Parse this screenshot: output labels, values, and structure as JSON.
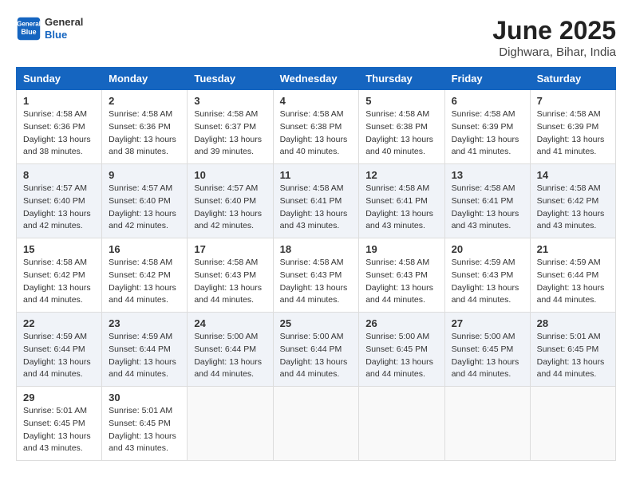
{
  "header": {
    "logo_line1": "General",
    "logo_line2": "Blue",
    "month": "June 2025",
    "location": "Dighwara, Bihar, India"
  },
  "weekdays": [
    "Sunday",
    "Monday",
    "Tuesday",
    "Wednesday",
    "Thursday",
    "Friday",
    "Saturday"
  ],
  "weeks": [
    [
      {
        "day": "1",
        "sunrise": "4:58 AM",
        "sunset": "6:36 PM",
        "daylight": "13 hours and 38 minutes."
      },
      {
        "day": "2",
        "sunrise": "4:58 AM",
        "sunset": "6:36 PM",
        "daylight": "13 hours and 38 minutes."
      },
      {
        "day": "3",
        "sunrise": "4:58 AM",
        "sunset": "6:37 PM",
        "daylight": "13 hours and 39 minutes."
      },
      {
        "day": "4",
        "sunrise": "4:58 AM",
        "sunset": "6:38 PM",
        "daylight": "13 hours and 40 minutes."
      },
      {
        "day": "5",
        "sunrise": "4:58 AM",
        "sunset": "6:38 PM",
        "daylight": "13 hours and 40 minutes."
      },
      {
        "day": "6",
        "sunrise": "4:58 AM",
        "sunset": "6:39 PM",
        "daylight": "13 hours and 41 minutes."
      },
      {
        "day": "7",
        "sunrise": "4:58 AM",
        "sunset": "6:39 PM",
        "daylight": "13 hours and 41 minutes."
      }
    ],
    [
      {
        "day": "8",
        "sunrise": "4:57 AM",
        "sunset": "6:40 PM",
        "daylight": "13 hours and 42 minutes."
      },
      {
        "day": "9",
        "sunrise": "4:57 AM",
        "sunset": "6:40 PM",
        "daylight": "13 hours and 42 minutes."
      },
      {
        "day": "10",
        "sunrise": "4:57 AM",
        "sunset": "6:40 PM",
        "daylight": "13 hours and 42 minutes."
      },
      {
        "day": "11",
        "sunrise": "4:58 AM",
        "sunset": "6:41 PM",
        "daylight": "13 hours and 43 minutes."
      },
      {
        "day": "12",
        "sunrise": "4:58 AM",
        "sunset": "6:41 PM",
        "daylight": "13 hours and 43 minutes."
      },
      {
        "day": "13",
        "sunrise": "4:58 AM",
        "sunset": "6:41 PM",
        "daylight": "13 hours and 43 minutes."
      },
      {
        "day": "14",
        "sunrise": "4:58 AM",
        "sunset": "6:42 PM",
        "daylight": "13 hours and 43 minutes."
      }
    ],
    [
      {
        "day": "15",
        "sunrise": "4:58 AM",
        "sunset": "6:42 PM",
        "daylight": "13 hours and 44 minutes."
      },
      {
        "day": "16",
        "sunrise": "4:58 AM",
        "sunset": "6:42 PM",
        "daylight": "13 hours and 44 minutes."
      },
      {
        "day": "17",
        "sunrise": "4:58 AM",
        "sunset": "6:43 PM",
        "daylight": "13 hours and 44 minutes."
      },
      {
        "day": "18",
        "sunrise": "4:58 AM",
        "sunset": "6:43 PM",
        "daylight": "13 hours and 44 minutes."
      },
      {
        "day": "19",
        "sunrise": "4:58 AM",
        "sunset": "6:43 PM",
        "daylight": "13 hours and 44 minutes."
      },
      {
        "day": "20",
        "sunrise": "4:59 AM",
        "sunset": "6:43 PM",
        "daylight": "13 hours and 44 minutes."
      },
      {
        "day": "21",
        "sunrise": "4:59 AM",
        "sunset": "6:44 PM",
        "daylight": "13 hours and 44 minutes."
      }
    ],
    [
      {
        "day": "22",
        "sunrise": "4:59 AM",
        "sunset": "6:44 PM",
        "daylight": "13 hours and 44 minutes."
      },
      {
        "day": "23",
        "sunrise": "4:59 AM",
        "sunset": "6:44 PM",
        "daylight": "13 hours and 44 minutes."
      },
      {
        "day": "24",
        "sunrise": "5:00 AM",
        "sunset": "6:44 PM",
        "daylight": "13 hours and 44 minutes."
      },
      {
        "day": "25",
        "sunrise": "5:00 AM",
        "sunset": "6:44 PM",
        "daylight": "13 hours and 44 minutes."
      },
      {
        "day": "26",
        "sunrise": "5:00 AM",
        "sunset": "6:45 PM",
        "daylight": "13 hours and 44 minutes."
      },
      {
        "day": "27",
        "sunrise": "5:00 AM",
        "sunset": "6:45 PM",
        "daylight": "13 hours and 44 minutes."
      },
      {
        "day": "28",
        "sunrise": "5:01 AM",
        "sunset": "6:45 PM",
        "daylight": "13 hours and 44 minutes."
      }
    ],
    [
      {
        "day": "29",
        "sunrise": "5:01 AM",
        "sunset": "6:45 PM",
        "daylight": "13 hours and 43 minutes."
      },
      {
        "day": "30",
        "sunrise": "5:01 AM",
        "sunset": "6:45 PM",
        "daylight": "13 hours and 43 minutes."
      },
      null,
      null,
      null,
      null,
      null
    ]
  ]
}
